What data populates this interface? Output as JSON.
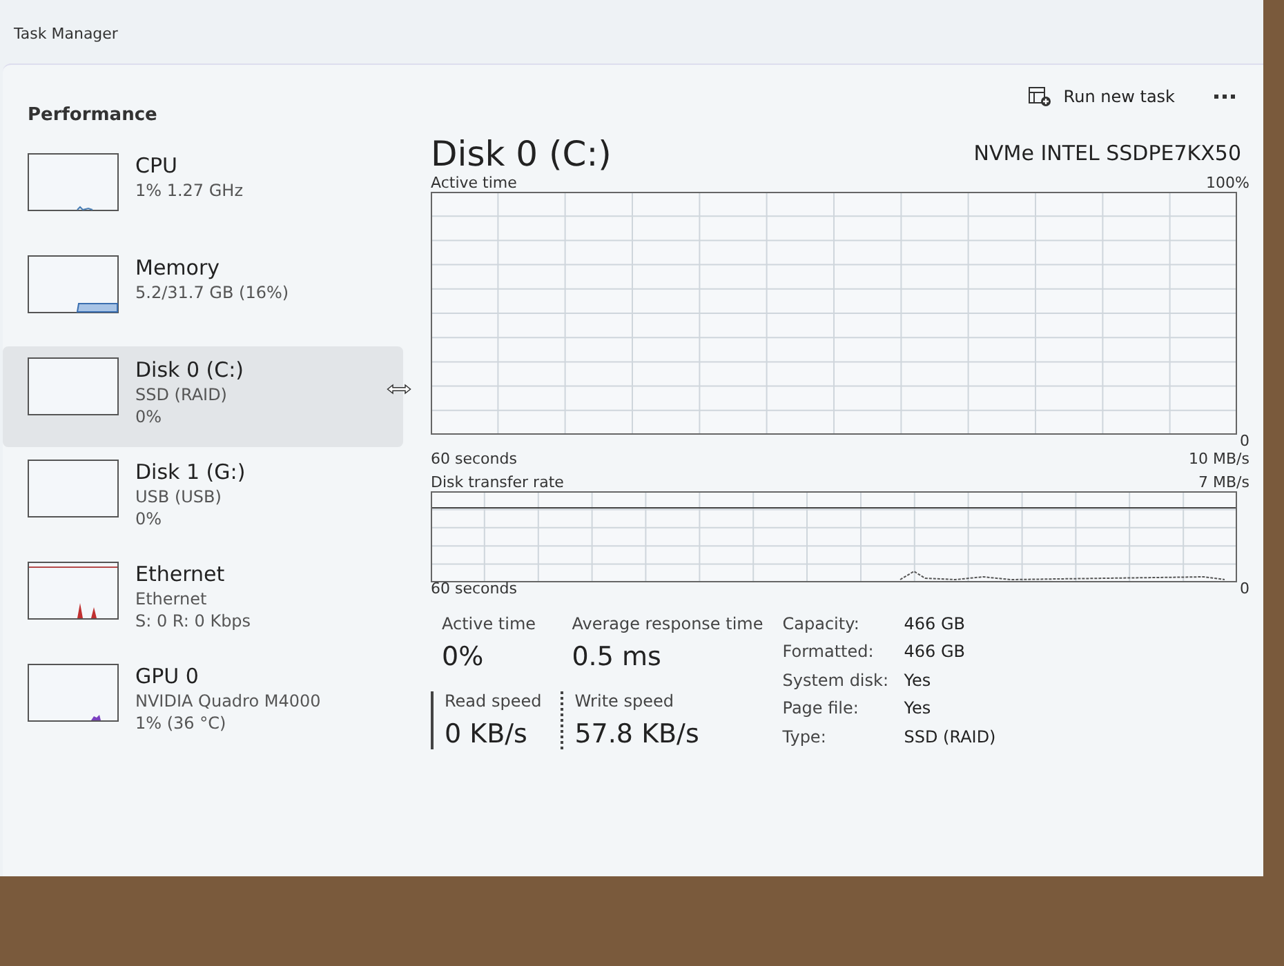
{
  "window": {
    "title": "Task Manager"
  },
  "header": {
    "title": "Performance",
    "run_new_task": "Run new task"
  },
  "sidebar": {
    "items": [
      {
        "kind": "cpu",
        "name": "CPU",
        "lines": [
          "1% 1.27 GHz"
        ],
        "selected": false
      },
      {
        "kind": "memory",
        "name": "Memory",
        "lines": [
          "5.2/31.7 GB (16%)"
        ],
        "selected": false
      },
      {
        "kind": "disk",
        "name": "Disk 0 (C:)",
        "lines": [
          "SSD (RAID)",
          "0%"
        ],
        "selected": true
      },
      {
        "kind": "disk",
        "name": "Disk 1 (G:)",
        "lines": [
          "USB (USB)",
          "0%"
        ],
        "selected": false
      },
      {
        "kind": "ethernet",
        "name": "Ethernet",
        "lines": [
          "Ethernet",
          "S: 0 R: 0 Kbps"
        ],
        "selected": false
      },
      {
        "kind": "gpu",
        "name": "GPU 0",
        "lines": [
          "NVIDIA Quadro M4000",
          "1% (36 °C)"
        ],
        "selected": false
      }
    ]
  },
  "detail": {
    "title": "Disk 0 (C:)",
    "model": "NVMe INTEL SSDPE7KX50",
    "active_time_graph": {
      "label": "Active time",
      "max": "100%",
      "min": "0",
      "duration": "60 seconds"
    },
    "transfer_graph": {
      "label": "Disk transfer rate",
      "max": "10 MB/s",
      "line_label": "7 MB/s",
      "min": "0",
      "duration": "60 seconds"
    },
    "stats": [
      {
        "kind": "plain",
        "label": "Active time",
        "value": "0%"
      },
      {
        "kind": "plain",
        "label": "Average response time",
        "value": "0.5 ms"
      },
      {
        "kind": "solid",
        "label": "Read speed",
        "value": "0 KB/s"
      },
      {
        "kind": "dotted",
        "label": "Write speed",
        "value": "57.8 KB/s"
      }
    ],
    "properties": [
      {
        "label": "Capacity:",
        "value": "466 GB"
      },
      {
        "label": "Formatted:",
        "value": "466 GB"
      },
      {
        "label": "System disk:",
        "value": "Yes"
      },
      {
        "label": "Page file:",
        "value": "Yes"
      },
      {
        "label": "Type:",
        "value": "SSD (RAID)"
      }
    ]
  }
}
